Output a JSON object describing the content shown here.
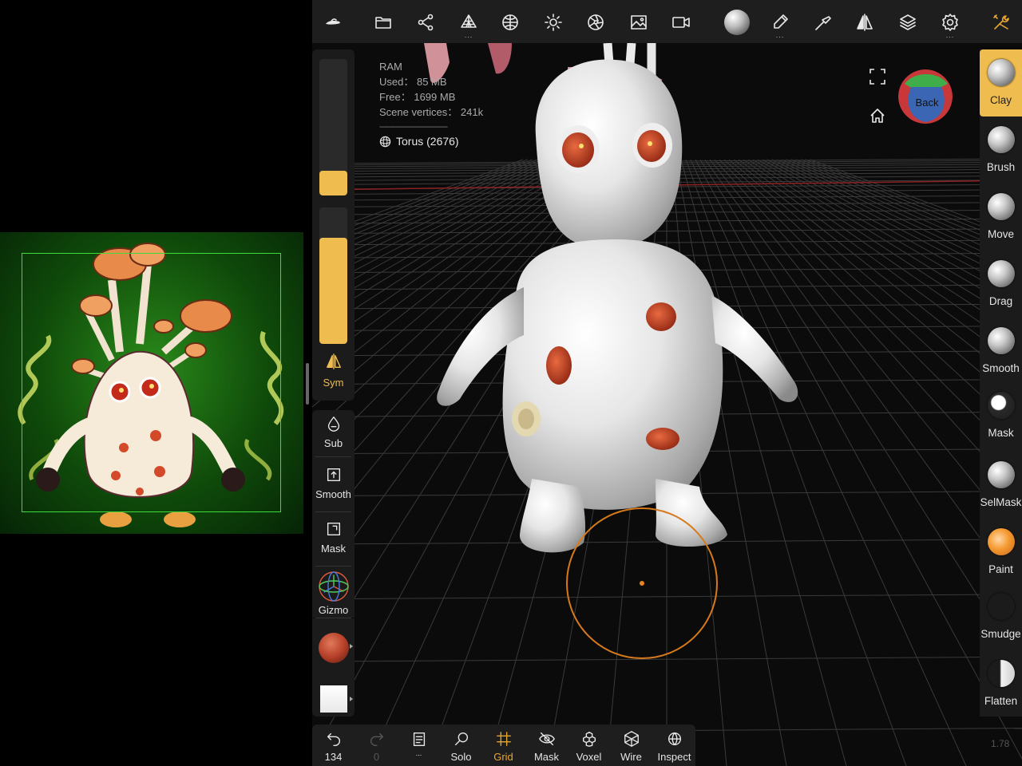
{
  "stats": {
    "ram_label": "RAM",
    "used": "Used： 85 MB",
    "free": "Free： 1699 MB",
    "vertices": "Scene vertices： 241k",
    "separator": "--------------------------------"
  },
  "object": {
    "name": "Torus (2676)",
    "icon": "torus-icon"
  },
  "viewcube": {
    "label": "Back",
    "colors": {
      "top": "#3fae4a",
      "left": "#c8383a",
      "front": "#3a66b4"
    }
  },
  "top_toolbar": {
    "items": [
      {
        "name": "logo-icon"
      },
      {
        "name": "folder-icon"
      },
      {
        "name": "scene-graph-icon"
      },
      {
        "name": "topology-icon"
      },
      {
        "name": "material-sphere-icon"
      },
      {
        "name": "light-icon"
      },
      {
        "name": "camera-aperture-icon"
      },
      {
        "name": "background-image-icon"
      },
      {
        "name": "video-camera-icon"
      },
      {
        "name": "matcap-ball-icon"
      },
      {
        "name": "brush-stroke-icon"
      },
      {
        "name": "picker-icon"
      },
      {
        "name": "symmetry-icon"
      },
      {
        "name": "layers-icon"
      },
      {
        "name": "settings-icon"
      },
      {
        "name": "tools-icon"
      }
    ],
    "dots": "..."
  },
  "left_panel": {
    "radius_value": 0.18,
    "intensity_value": 0.78,
    "sym_label": "Sym",
    "sub_label": "Sub",
    "smooth_label": "Smooth",
    "mask_label": "Mask",
    "gizmo_label": "Gizmo",
    "material_color": "#b8412a"
  },
  "right_panel": {
    "tools": [
      "Clay",
      "Brush",
      "Move",
      "Drag",
      "Smooth",
      "Mask",
      "SelMask",
      "Paint",
      "Smudge",
      "Flatten"
    ],
    "active": "Clay"
  },
  "bottom_toolbar": {
    "undo_count": "134",
    "redo_count": "0",
    "dots": "...",
    "solo": "Solo",
    "grid": "Grid",
    "mask": "Mask",
    "voxel": "Voxel",
    "wire": "Wire",
    "inspect": "Inspect"
  },
  "version": "1.78",
  "accent_color": "#efbc4f"
}
